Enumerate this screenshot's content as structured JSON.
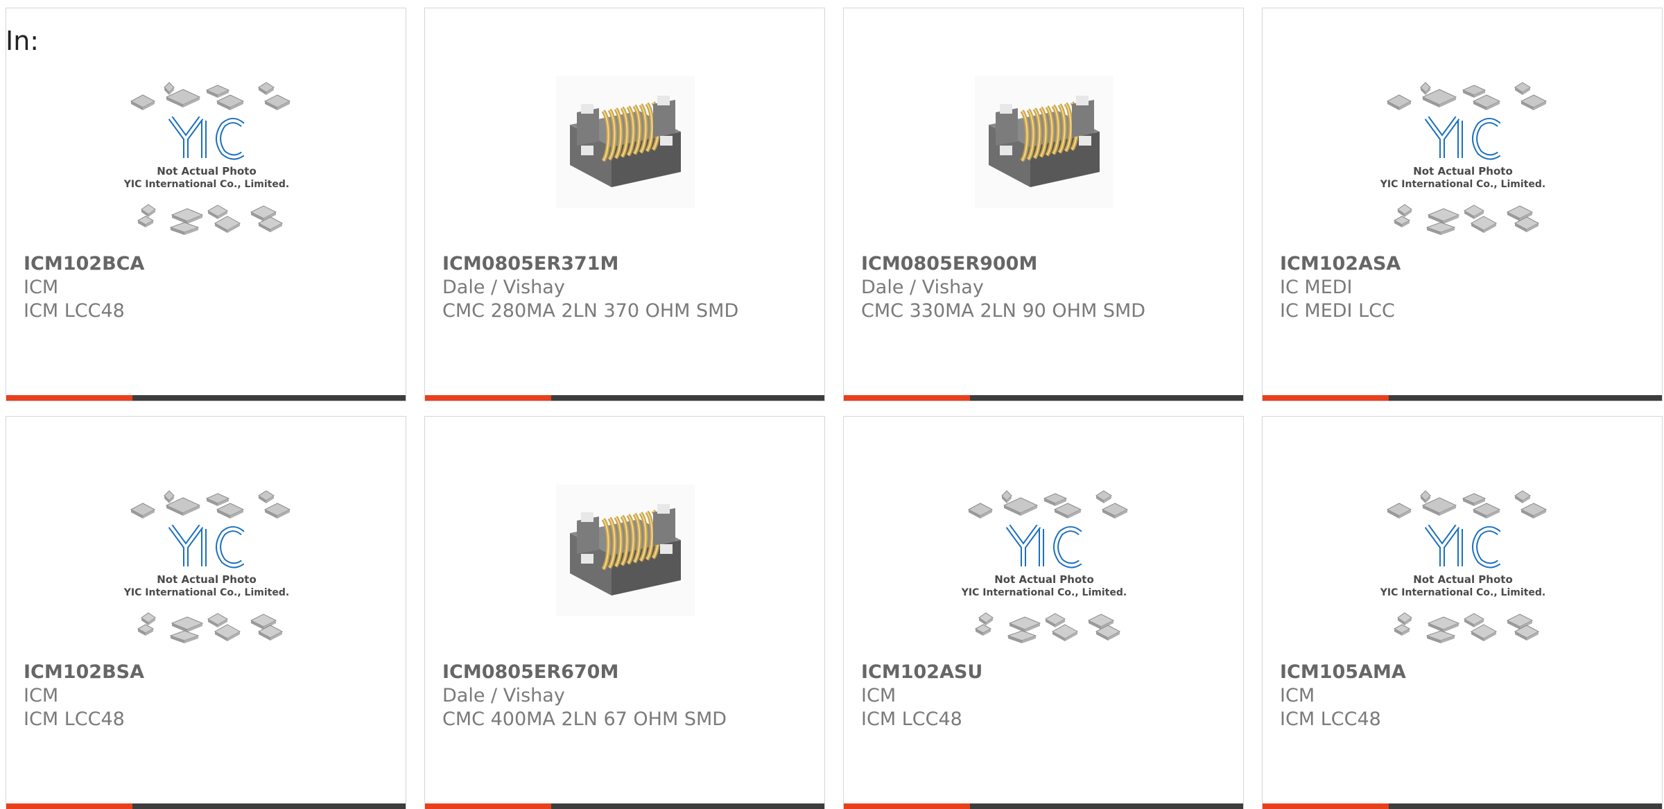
{
  "heading": "In:",
  "colors": {
    "accent": "#e8401c",
    "bar": "#3d3d3d",
    "yic_logo": "#1b6fbf"
  },
  "placeholder_photo": {
    "line1": "Not Actual Photo",
    "line2": "YIC International Co., Limited.",
    "logo_text": "YIC"
  },
  "products": [
    {
      "part": "ICM102BCA",
      "manufacturer": "ICM",
      "description": "ICM LCC48",
      "image": "yic-placeholder-icon"
    },
    {
      "part": "ICM0805ER371M",
      "manufacturer": "Dale / Vishay",
      "description": "CMC 280MA 2LN 370 OHM SMD",
      "image": "inductor-icon"
    },
    {
      "part": "ICM0805ER900M",
      "manufacturer": "Dale / Vishay",
      "description": "CMC 330MA 2LN 90 OHM SMD",
      "image": "inductor-icon"
    },
    {
      "part": "ICM102ASA",
      "manufacturer": "IC MEDI",
      "description": "IC MEDI LCC",
      "image": "yic-placeholder-icon"
    },
    {
      "part": "ICM102BSA",
      "manufacturer": "ICM",
      "description": "ICM LCC48",
      "image": "yic-placeholder-icon"
    },
    {
      "part": "ICM0805ER670M",
      "manufacturer": "Dale / Vishay",
      "description": "CMC 400MA 2LN 67 OHM SMD",
      "image": "inductor-icon"
    },
    {
      "part": "ICM102ASU",
      "manufacturer": "ICM",
      "description": "ICM LCC48",
      "image": "yic-placeholder-icon"
    },
    {
      "part": "ICM105AMA",
      "manufacturer": "ICM",
      "description": "ICM LCC48",
      "image": "yic-placeholder-icon"
    }
  ]
}
